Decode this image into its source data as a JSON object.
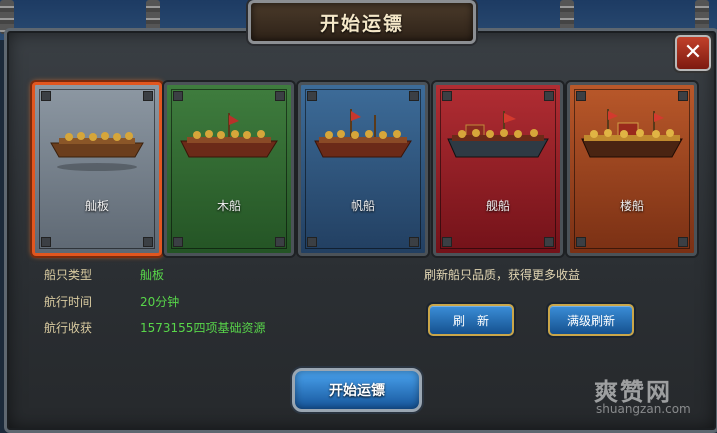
{
  "window": {
    "title": "开始运镖",
    "close_label": "✕"
  },
  "ships": [
    {
      "name": "舢板",
      "color": "#7d8893",
      "selected": true
    },
    {
      "name": "木船",
      "color": "#2f6b30"
    },
    {
      "name": "帆船",
      "color": "#2e5680"
    },
    {
      "name": "舰船",
      "color": "#951f26"
    },
    {
      "name": "楼船",
      "color": "#9a451f"
    }
  ],
  "info": {
    "ship_type_label": "船只类型",
    "ship_type_value": "舢板",
    "sail_time_label": "航行时间",
    "sail_time_value": "20分钟",
    "reward_label": "航行收获",
    "reward_value": "1573155四项基础资源"
  },
  "refresh_tip": "刷新船只品质，获得更多收益",
  "buttons": {
    "refresh": "刷　新",
    "max_refresh": "满级刷新",
    "start": "开始运镖"
  },
  "watermark": {
    "main": "爽赞网",
    "sub": "shuangzan.com"
  }
}
